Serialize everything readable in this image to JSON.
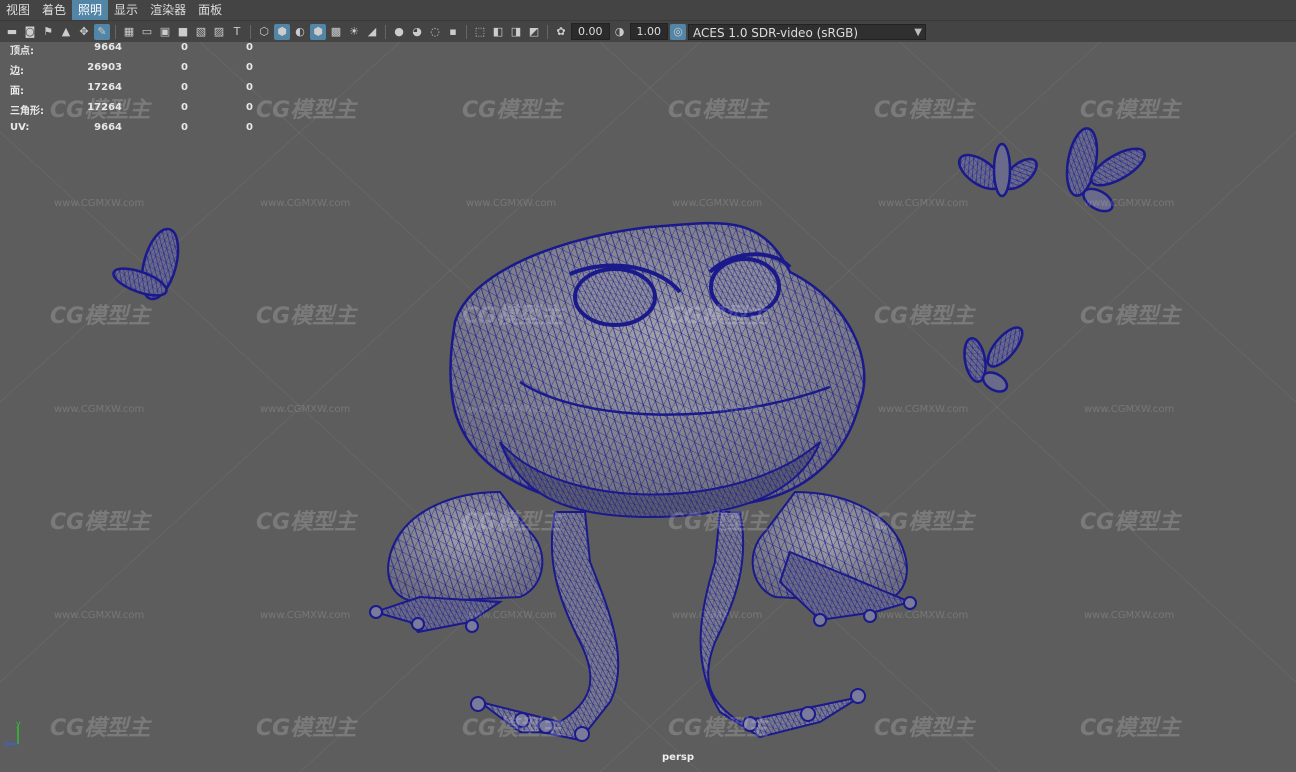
{
  "menu": {
    "items": [
      {
        "label": "视图",
        "active": false
      },
      {
        "label": "着色",
        "active": false
      },
      {
        "label": "照明",
        "active": true
      },
      {
        "label": "显示",
        "active": false
      },
      {
        "label": "渲染器",
        "active": false
      },
      {
        "label": "面板",
        "active": false
      }
    ]
  },
  "toolbar": {
    "exposure_value": "0.00",
    "gamma_value": "1.00",
    "colorspace_label": "ACES 1.0 SDR-video (sRGB)"
  },
  "hud": {
    "rows": [
      {
        "label": "顶点:",
        "a": "9664",
        "b": "0",
        "c": "0"
      },
      {
        "label": "边:",
        "a": "26903",
        "b": "0",
        "c": "0"
      },
      {
        "label": "面:",
        "a": "17264",
        "b": "0",
        "c": "0"
      },
      {
        "label": "三角形:",
        "a": "17264",
        "b": "0",
        "c": "0"
      },
      {
        "label": "UV:",
        "a": "9664",
        "b": "0",
        "c": "0"
      }
    ]
  },
  "viewport": {
    "camera_label": "persp",
    "watermark_logo": "CG模型主",
    "watermark_url": "www.CGMXW.com",
    "axis_y": "y",
    "axis_z": "z"
  },
  "colors": {
    "wire": "#1a1a8c",
    "model_fill": "#8a8a96",
    "accent": "#5285a6"
  }
}
